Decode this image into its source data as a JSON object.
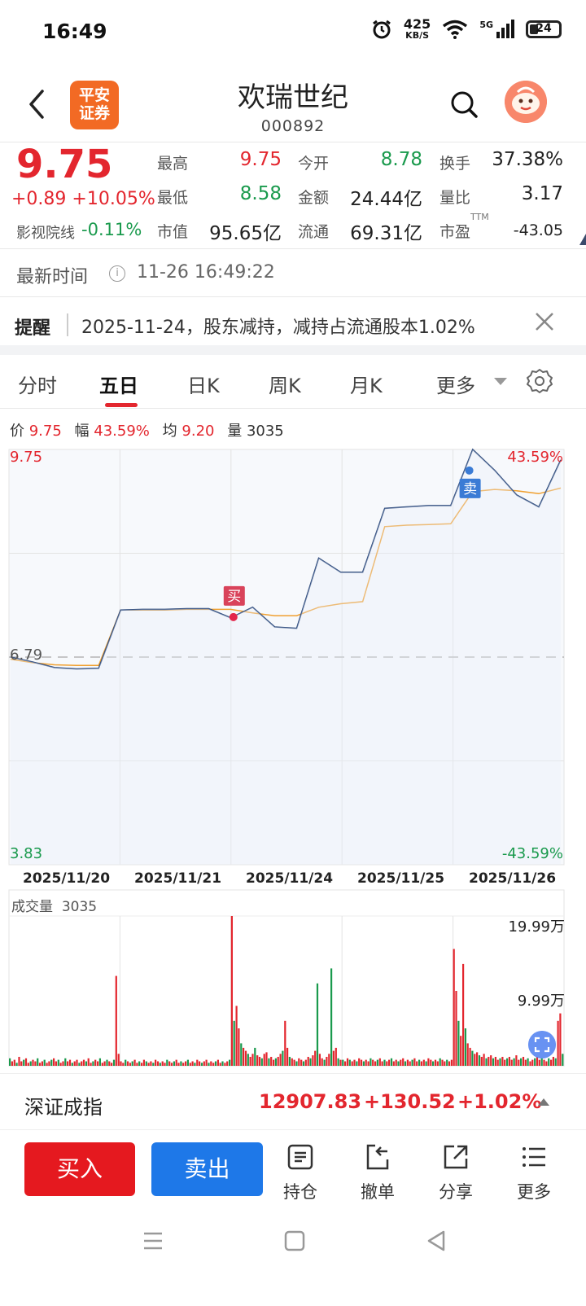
{
  "status_bar": {
    "time": "16:49",
    "net_speed": "425",
    "net_unit": "KB/S",
    "signal": "5G",
    "battery": "24"
  },
  "header": {
    "logo_line1": "平安",
    "logo_line2": "证券",
    "title": "欢瑞世纪",
    "code": "000892"
  },
  "quote": {
    "price": "9.75",
    "change": "+0.89 +10.05%",
    "yingshi_label": "影视院线",
    "yingshi_value": "-0.11%",
    "fields": [
      {
        "label": "最高",
        "value": "9.75"
      },
      {
        "label": "今开",
        "value": "8.78"
      },
      {
        "label": "换手",
        "value": "37.38%"
      },
      {
        "label": "最低",
        "value": "8.58"
      },
      {
        "label": "金额",
        "value": "24.44亿"
      },
      {
        "label": "量比",
        "value": "3.17"
      },
      {
        "label": "市值",
        "value": "95.65亿"
      },
      {
        "label": "流通",
        "value": "69.31亿"
      },
      {
        "label": "市盈",
        "value": "-43.05",
        "sup": "TTM"
      }
    ]
  },
  "latest": {
    "label": "最新时间",
    "info": "i",
    "time": "11-26 16:49:22"
  },
  "reminder": {
    "label": "提醒",
    "text": "2025-11-24，股东减持，减持占流通股本1.02%"
  },
  "tabs": [
    "分时",
    "五日",
    "日K",
    "周K",
    "月K",
    "更多"
  ],
  "active_tab": "五日",
  "chart_info": {
    "price_label": "价",
    "price": "9.75",
    "amp_label": "幅",
    "amp": "43.59%",
    "avg_label": "均",
    "avg": "9.20",
    "vol_label": "量",
    "vol": "3035"
  },
  "chart_data": {
    "type": "line",
    "title": "",
    "xlabel": "",
    "ylabel": "",
    "ylim": [
      3.83,
      9.75
    ],
    "y_tick_labels": {
      "top": "9.75",
      "bottom": "3.83",
      "top_pct": "43.59%",
      "bottom_pct": "-43.59%",
      "prev_close": "6.79"
    },
    "x": [
      "2025/11/20",
      "2025/11/21",
      "2025/11/24",
      "2025/11/25",
      "2025/11/26"
    ],
    "series": [
      {
        "values": [
          6.79,
          6.72,
          6.64,
          6.62,
          6.63,
          7.46,
          7.47,
          7.47,
          7.48,
          7.48,
          7.35,
          7.5,
          7.22,
          7.2,
          8.2,
          8.0,
          8.0,
          8.91,
          8.93,
          8.95,
          8.95,
          9.75,
          9.45,
          9.1,
          8.93,
          9.6
        ]
      },
      {
        "values": [
          6.76,
          6.71,
          6.68,
          6.67,
          6.67,
          7.46,
          7.46,
          7.46,
          7.47,
          7.47,
          7.47,
          7.42,
          7.38,
          7.38,
          7.5,
          7.55,
          7.58,
          8.65,
          8.67,
          8.68,
          8.69,
          9.15,
          9.18,
          9.16,
          9.12,
          9.2
        ]
      }
    ],
    "markers": [
      {
        "label": "买",
        "date": "2025/11/24",
        "price": 7.36
      },
      {
        "label": "卖",
        "date": "2025/11/26",
        "price": 9.45
      }
    ],
    "volume": {
      "label": "成交量",
      "value": "3035",
      "max_label": "19.99万",
      "mid_label": "9.99万",
      "days": [
        {
          "date": "2025/11/20",
          "bars": [
            5,
            3,
            4,
            2,
            6,
            3,
            4,
            5,
            2,
            3,
            4,
            3,
            5,
            2,
            3,
            4,
            2,
            3,
            4,
            5,
            3,
            4,
            2,
            3,
            5,
            3,
            4,
            2,
            3,
            4,
            2,
            3,
            4,
            3,
            5,
            2,
            3,
            4,
            3,
            5,
            2,
            3,
            4,
            3,
            2,
            4,
            60,
            8
          ]
        },
        {
          "date": "2025/11/21",
          "bars": [
            3,
            2,
            4,
            3,
            2,
            3,
            4,
            2,
            3,
            2,
            4,
            3,
            2,
            3,
            2,
            4,
            3,
            2,
            3,
            2,
            4,
            3,
            2,
            3,
            4,
            2,
            3,
            2,
            3,
            4,
            2,
            3,
            2,
            4,
            3,
            2,
            3,
            4,
            2,
            3,
            2,
            3,
            4,
            2,
            3,
            2,
            3,
            4
          ]
        },
        {
          "date": "2025/11/24",
          "bars": [
            100,
            30,
            40,
            25,
            15,
            12,
            10,
            8,
            6,
            8,
            12,
            7,
            6,
            5,
            8,
            9,
            5,
            6,
            4,
            5,
            6,
            8,
            10,
            30,
            12,
            6,
            5,
            4,
            3,
            5,
            4,
            3,
            4,
            6,
            5,
            7,
            10,
            55,
            8,
            5,
            4,
            6,
            8,
            65,
            10,
            12,
            5,
            4
          ]
        },
        {
          "date": "2025/11/25",
          "bars": [
            4,
            3,
            5,
            4,
            3,
            4,
            3,
            5,
            4,
            3,
            4,
            3,
            5,
            4,
            3,
            4,
            5,
            3,
            4,
            3,
            4,
            5,
            3,
            4,
            3,
            4,
            5,
            3,
            4,
            3,
            4,
            5,
            3,
            4,
            3,
            4,
            3,
            5,
            4,
            3,
            4,
            3,
            5,
            4,
            3,
            4,
            3,
            4
          ]
        },
        {
          "date": "2025/11/26",
          "bars": [
            78,
            50,
            30,
            20,
            68,
            25,
            15,
            12,
            10,
            8,
            9,
            7,
            6,
            8,
            5,
            6,
            7,
            5,
            6,
            4,
            5,
            6,
            4,
            5,
            6,
            4,
            5,
            7,
            4,
            5,
            6,
            4,
            5,
            3,
            4,
            5,
            6,
            4,
            5,
            4,
            3,
            5,
            4,
            6,
            5,
            30,
            35,
            8
          ]
        }
      ]
    }
  },
  "index": {
    "name": "深证成指",
    "value": "12907.83",
    "change": "+130.52",
    "pct": "+1.02%"
  },
  "actions": {
    "buy": "买入",
    "sell": "卖出",
    "items": [
      "持仓",
      "撤单",
      "分享",
      "更多"
    ]
  },
  "colors": {
    "up": "#e3262e",
    "down": "#1a9a4d",
    "price_line": "#2d4a7c",
    "avg_line": "#f0a030",
    "buy_btn": "#e5191f",
    "sell_btn": "#1e78e8"
  }
}
